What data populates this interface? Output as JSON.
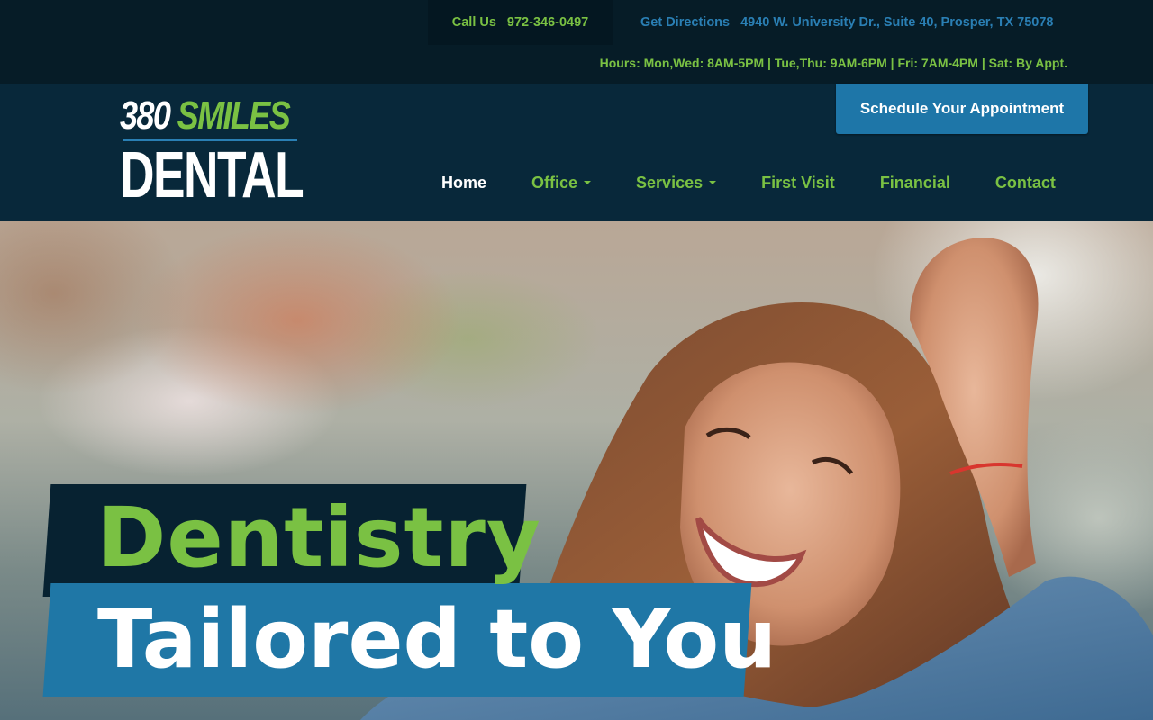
{
  "topbar": {
    "call_label": "Call Us",
    "phone": "972-346-0497",
    "directions_label": "Get Directions",
    "address": "4940 W. University Dr., Suite 40, Prosper, TX 75078",
    "hours": "Hours: Mon,Wed: 8AM-5PM | Tue,Thu: 9AM-6PM | Fri: 7AM-4PM | Sat: By Appt."
  },
  "logo": {
    "line1_a": "380",
    "line1_b": "SMILES",
    "line2": "DENTAL"
  },
  "header": {
    "schedule_label": "Schedule Your Appointment"
  },
  "nav": {
    "items": [
      {
        "label": "Home",
        "active": true,
        "dropdown": false
      },
      {
        "label": "Office",
        "active": false,
        "dropdown": true
      },
      {
        "label": "Services",
        "active": false,
        "dropdown": true
      },
      {
        "label": "First Visit",
        "active": false,
        "dropdown": false
      },
      {
        "label": "Financial",
        "active": false,
        "dropdown": false
      },
      {
        "label": "Contact",
        "active": false,
        "dropdown": false
      }
    ]
  },
  "hero": {
    "headline_line1": "Dentistry",
    "headline_line2": "Tailored to You"
  },
  "colors": {
    "brand_green": "#7ac143",
    "brand_blue": "#1f77a6",
    "navy": "#08283a"
  }
}
